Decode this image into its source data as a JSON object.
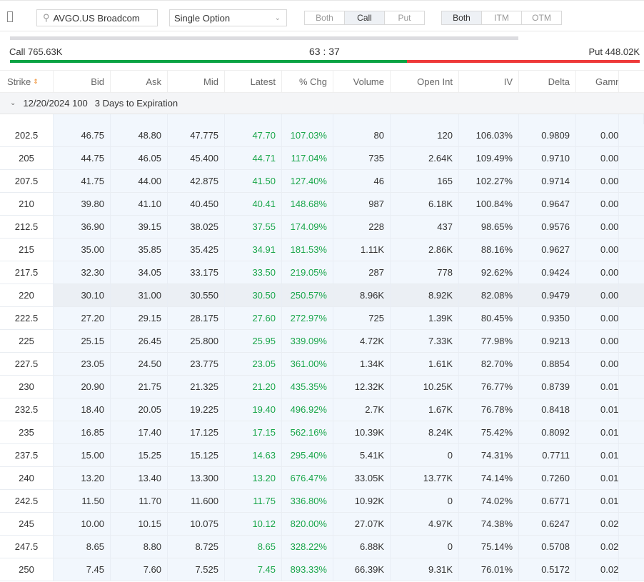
{
  "toolbar": {
    "search_value": "AVGO.US Broadcom",
    "strategy_select": "Single Option",
    "side_filter": [
      "Both",
      "Call",
      "Put"
    ],
    "side_selected": "Call",
    "moneyness_filter": [
      "Both",
      "ITM",
      "OTM"
    ],
    "moneyness_selected": "Both"
  },
  "ratio": {
    "call_label": "Call 765.63K",
    "put_label": "Put 448.02K",
    "ratio_text": "63 : 37",
    "call_share": 63,
    "call_color": "#0aa344",
    "put_color": "#ee3a3a"
  },
  "columns": [
    "Strike",
    "Bid",
    "Ask",
    "Mid",
    "Latest",
    "% Chg",
    "Volume",
    "Open Int",
    "IV",
    "Delta",
    "Gamma"
  ],
  "group": {
    "expiry": "12/20/2024 100",
    "days": "3 Days to Expiration"
  },
  "rows": [
    [
      "202.5",
      "46.75",
      "48.80",
      "47.775",
      "47.70",
      "107.03%",
      "80",
      "120",
      "106.03%",
      "0.9809",
      "0.00"
    ],
    [
      "205",
      "44.75",
      "46.05",
      "45.400",
      "44.71",
      "117.04%",
      "735",
      "2.64K",
      "109.49%",
      "0.9710",
      "0.00"
    ],
    [
      "207.5",
      "41.75",
      "44.00",
      "42.875",
      "41.50",
      "127.40%",
      "46",
      "165",
      "102.27%",
      "0.9714",
      "0.00"
    ],
    [
      "210",
      "39.80",
      "41.10",
      "40.450",
      "40.41",
      "148.68%",
      "987",
      "6.18K",
      "100.84%",
      "0.9647",
      "0.00"
    ],
    [
      "212.5",
      "36.90",
      "39.15",
      "38.025",
      "37.55",
      "174.09%",
      "228",
      "437",
      "98.65%",
      "0.9576",
      "0.00"
    ],
    [
      "215",
      "35.00",
      "35.85",
      "35.425",
      "34.91",
      "181.53%",
      "1.11K",
      "2.86K",
      "88.16%",
      "0.9627",
      "0.00"
    ],
    [
      "217.5",
      "32.30",
      "34.05",
      "33.175",
      "33.50",
      "219.05%",
      "287",
      "778",
      "92.62%",
      "0.9424",
      "0.00"
    ],
    [
      "220",
      "30.10",
      "31.00",
      "30.550",
      "30.50",
      "250.57%",
      "8.96K",
      "8.92K",
      "82.08%",
      "0.9479",
      "0.00"
    ],
    [
      "222.5",
      "27.20",
      "29.15",
      "28.175",
      "27.60",
      "272.97%",
      "725",
      "1.39K",
      "80.45%",
      "0.9350",
      "0.00"
    ],
    [
      "225",
      "25.15",
      "26.45",
      "25.800",
      "25.95",
      "339.09%",
      "4.72K",
      "7.33K",
      "77.98%",
      "0.9213",
      "0.00"
    ],
    [
      "227.5",
      "23.05",
      "24.50",
      "23.775",
      "23.05",
      "361.00%",
      "1.34K",
      "1.61K",
      "82.70%",
      "0.8854",
      "0.00"
    ],
    [
      "230",
      "20.90",
      "21.75",
      "21.325",
      "21.20",
      "435.35%",
      "12.32K",
      "10.25K",
      "76.77%",
      "0.8739",
      "0.01"
    ],
    [
      "232.5",
      "18.40",
      "20.05",
      "19.225",
      "19.40",
      "496.92%",
      "2.7K",
      "1.67K",
      "76.78%",
      "0.8418",
      "0.01"
    ],
    [
      "235",
      "16.85",
      "17.40",
      "17.125",
      "17.15",
      "562.16%",
      "10.39K",
      "8.24K",
      "75.42%",
      "0.8092",
      "0.01"
    ],
    [
      "237.5",
      "15.00",
      "15.25",
      "15.125",
      "14.63",
      "295.40%",
      "5.41K",
      "0",
      "74.31%",
      "0.7711",
      "0.01"
    ],
    [
      "240",
      "13.20",
      "13.40",
      "13.300",
      "13.20",
      "676.47%",
      "33.05K",
      "13.77K",
      "74.14%",
      "0.7260",
      "0.01"
    ],
    [
      "242.5",
      "11.50",
      "11.70",
      "11.600",
      "11.75",
      "336.80%",
      "10.92K",
      "0",
      "74.02%",
      "0.6771",
      "0.01"
    ],
    [
      "245",
      "10.00",
      "10.15",
      "10.075",
      "10.12",
      "820.00%",
      "27.07K",
      "4.97K",
      "74.38%",
      "0.6247",
      "0.02"
    ],
    [
      "247.5",
      "8.65",
      "8.80",
      "8.725",
      "8.65",
      "328.22%",
      "6.88K",
      "0",
      "75.14%",
      "0.5708",
      "0.02"
    ],
    [
      "250",
      "7.45",
      "7.60",
      "7.525",
      "7.45",
      "893.33%",
      "66.39K",
      "9.31K",
      "76.01%",
      "0.5172",
      "0.02"
    ]
  ],
  "highlighted_strike": "220"
}
